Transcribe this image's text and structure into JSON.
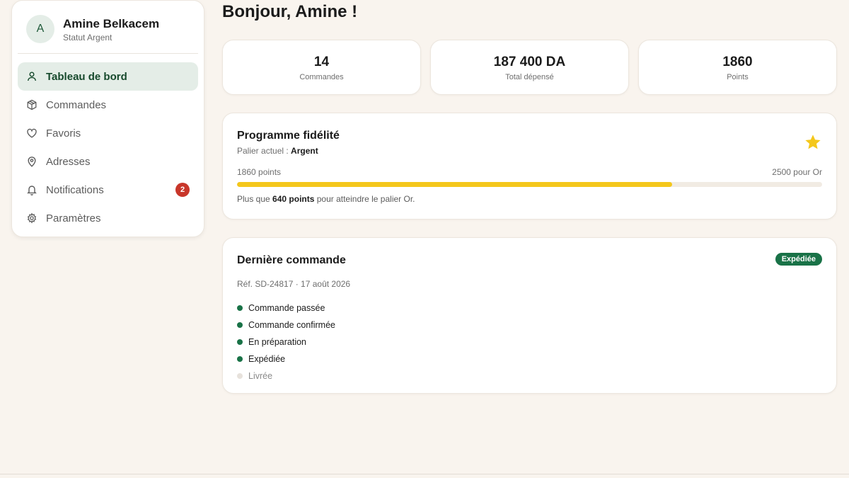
{
  "profile": {
    "initial": "A",
    "name": "Amine Belkacem",
    "status": "Statut Argent"
  },
  "nav": [
    {
      "label": "Tableau de bord",
      "icon": "user-icon",
      "active": true
    },
    {
      "label": "Commandes",
      "icon": "package-icon"
    },
    {
      "label": "Favoris",
      "icon": "heart-icon"
    },
    {
      "label": "Adresses",
      "icon": "map-pin-icon"
    },
    {
      "label": "Notifications",
      "icon": "bell-icon",
      "badge": "2"
    },
    {
      "label": "Paramètres",
      "icon": "gear-icon"
    }
  ],
  "greeting": "Bonjour, Amine !",
  "stats": [
    {
      "value": "14",
      "label": "Commandes"
    },
    {
      "value": "187 400 DA",
      "label": "Total dépensé"
    },
    {
      "value": "1860",
      "label": "Points"
    }
  ],
  "loyalty": {
    "title": "Programme fidélité",
    "tier_prefix": "Palier actuel : ",
    "tier": "Argent",
    "points_label": "1860 points",
    "target_label": "2500 pour Or",
    "progress": 0.744,
    "note_prefix": "Plus que ",
    "note_points": "640 points",
    "note_suffix": " pour atteindre le palier Or.",
    "star_color": "#f4c71b"
  },
  "order": {
    "title": "Dernière commande",
    "status": "Expédiée",
    "ref": "Réf. SD-24817 · 17 août 2026",
    "steps": [
      {
        "label": "Commande passée",
        "done": true
      },
      {
        "label": "Commande confirmée",
        "done": true
      },
      {
        "label": "En préparation",
        "done": true
      },
      {
        "label": "Expédiée",
        "done": true
      },
      {
        "label": "Livrée",
        "done": false
      }
    ]
  },
  "colors": {
    "accent": "#197247",
    "background": "#f9f4ee",
    "badge": "#c8362a"
  }
}
